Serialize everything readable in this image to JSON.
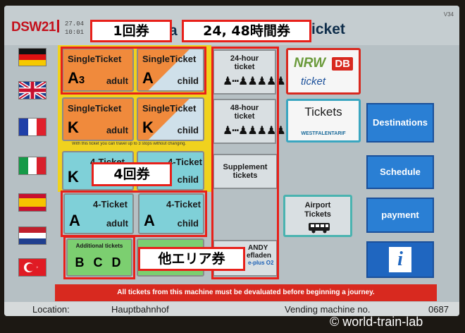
{
  "header": {
    "logo": "DSW21",
    "date_line": "27.04",
    "time_line": "10:01",
    "title_frag_1": "a",
    "title_frag_2": "icket",
    "version": "V34"
  },
  "annotations": {
    "single": "1回券",
    "hours": "24, 48時間券",
    "four": "4回券",
    "other": "他エリア券"
  },
  "tickets": {
    "single_a_adult": {
      "name": "SingleTicket",
      "zone": "A",
      "zone_sub": "3",
      "who": "adult"
    },
    "single_a_child": {
      "name": "SingleTicket",
      "zone": "A",
      "who": "child"
    },
    "single_k_adult": {
      "name": "SingleTicket",
      "zone": "K",
      "who": "adult"
    },
    "single_k_child": {
      "name": "SingleTicket",
      "zone": "K",
      "who": "child"
    },
    "info_line": "With this ticket you can travel up to 3 stops without changing.",
    "four_k_adult": {
      "name": "4-Ticket",
      "zone": "K"
    },
    "four_k_child": {
      "name": "4-Ticket",
      "who": "child"
    },
    "four_a_adult": {
      "name": "4-Ticket",
      "zone": "A",
      "who": "adult"
    },
    "four_a_child": {
      "name": "4-Ticket",
      "zone": "A",
      "who": "child"
    },
    "additional": {
      "name": "Additional tickets",
      "zones": "B C D"
    }
  },
  "middle": {
    "hour24": {
      "line1": "24-hour",
      "line2": "ticket"
    },
    "hour48": {
      "line1": "48-hour",
      "line2": "ticket"
    },
    "supplement": {
      "line1": "Supplement",
      "line2": "tickets"
    },
    "andy": {
      "line1": "ANDY",
      "line2": "efladen",
      "line3": "e-plus O2"
    }
  },
  "right": {
    "nrw": {
      "brand": "NRW",
      "db": "DB",
      "sub": "ticket"
    },
    "tickets_wf": {
      "label": "Tickets",
      "sub": "WESTFALENTARIF"
    },
    "airport": {
      "line1": "Airport",
      "line2": "Tickets"
    },
    "destinations": "Destinations",
    "schedule": "Schedule",
    "payment": "payment",
    "info_glyph": "i"
  },
  "notice": "All tickets from this machine must be devaluated before beginning a journey.",
  "footer": {
    "location_label": "Location:",
    "location_value": "Hauptbahnhof",
    "vm_label": "Vending machine no.",
    "vm_value": "0687"
  },
  "watermark": "© world-train-lab",
  "colors": {
    "single_adult": "#f08a3c",
    "child": "#cfe0ea",
    "four_ticket": "#7fd0d8",
    "additional": "#7ccf70",
    "yellow": "#f0d21e",
    "blue": "#2a7fd4",
    "annotation_red": "#e8201a",
    "notice_red": "#d8291f"
  }
}
